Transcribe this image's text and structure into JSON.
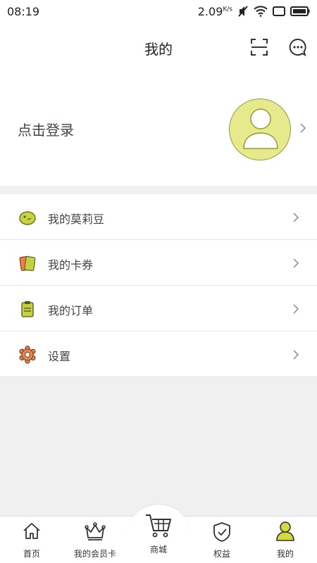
{
  "status": {
    "time": "08:19",
    "speed": "2.09",
    "speed_unit": "K/s"
  },
  "header": {
    "title": "我的",
    "scan_icon": "scan-icon",
    "message_icon": "message-icon"
  },
  "profile": {
    "login_text": "点击登录",
    "avatar_icon": "user-avatar-icon"
  },
  "menu": {
    "items": [
      {
        "label": "我的莫莉豆",
        "icon": "bean-icon"
      },
      {
        "label": "我的卡券",
        "icon": "coupon-icon"
      },
      {
        "label": "我的订单",
        "icon": "order-icon"
      },
      {
        "label": "设置",
        "icon": "settings-gear-icon"
      }
    ]
  },
  "tabbar": {
    "tabs": [
      {
        "label": "首页",
        "icon": "home-icon"
      },
      {
        "label": "我的会员卡",
        "icon": "crown-icon"
      },
      {
        "label": "商城",
        "icon": "cart-icon"
      },
      {
        "label": "权益",
        "icon": "shield-icon"
      },
      {
        "label": "我的",
        "icon": "person-icon",
        "active": true
      }
    ]
  },
  "colors": {
    "accent": "#d4da3a",
    "avatar_bg": "#e6e98c",
    "background": "#eff0ef"
  }
}
